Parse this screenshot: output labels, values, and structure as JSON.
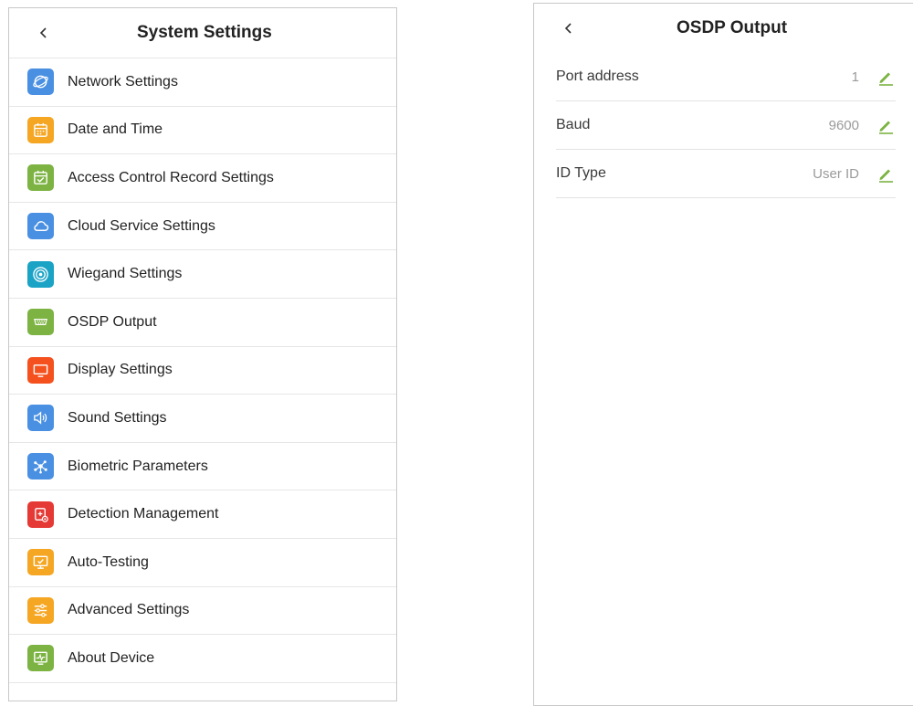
{
  "system_settings": {
    "title": "System Settings",
    "items": [
      {
        "label": "Network Settings",
        "icon": "globe-icon",
        "color": "#4a90e2"
      },
      {
        "label": "Date and Time",
        "icon": "calendar-icon",
        "color": "#f5a623"
      },
      {
        "label": "Access Control Record Settings",
        "icon": "calendar-check-icon",
        "color": "#7cb342"
      },
      {
        "label": "Cloud Service Settings",
        "icon": "cloud-icon",
        "color": "#4a90e2"
      },
      {
        "label": "Wiegand Settings",
        "icon": "target-icon",
        "color": "#1ba3c6"
      },
      {
        "label": "OSDP Output",
        "icon": "serial-port-icon",
        "color": "#7cb342"
      },
      {
        "label": "Display Settings",
        "icon": "monitor-icon",
        "color": "#f4511e"
      },
      {
        "label": "Sound Settings",
        "icon": "speaker-icon",
        "color": "#4a90e2"
      },
      {
        "label": "Biometric Parameters",
        "icon": "network-nodes-icon",
        "color": "#4a90e2"
      },
      {
        "label": "Detection Management",
        "icon": "detection-icon",
        "color": "#e53935"
      },
      {
        "label": "Auto-Testing",
        "icon": "monitor-check-icon",
        "color": "#f5a623"
      },
      {
        "label": "Advanced Settings",
        "icon": "sliders-icon",
        "color": "#f5a623"
      },
      {
        "label": "About Device",
        "icon": "device-info-icon",
        "color": "#7cb342"
      }
    ]
  },
  "osdp_output": {
    "title": "OSDP Output",
    "rows": [
      {
        "label": "Port address",
        "value": "1"
      },
      {
        "label": "Baud",
        "value": "9600"
      },
      {
        "label": "ID Type",
        "value": "User ID"
      }
    ],
    "edit_icon_color": "#7cb342"
  }
}
